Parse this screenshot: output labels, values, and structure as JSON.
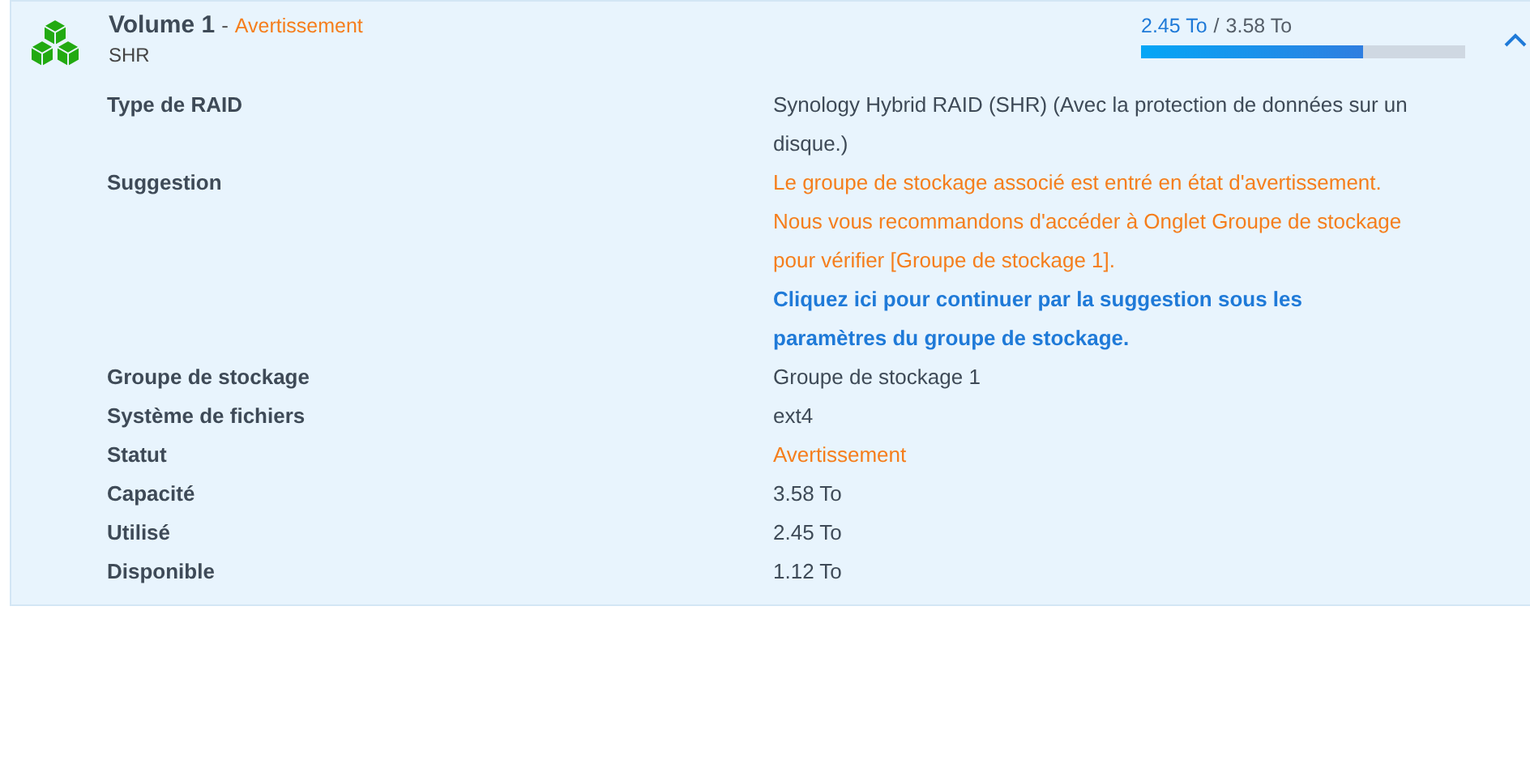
{
  "volume": {
    "name": "Volume 1",
    "separator": "-",
    "status": "Avertissement",
    "type": "SHR",
    "expanded": true,
    "usage": {
      "used": "2.45 To",
      "slash": "/",
      "total": "3.58 To",
      "level": 0.684
    },
    "details": [
      {
        "label": "Type de RAID",
        "kind": "plain",
        "value": "Synology Hybrid RAID (SHR) (Avec la protection de données sur un disque.)"
      },
      {
        "label": "Suggestion",
        "kind": "suggestion",
        "value": "Le groupe de stockage associé est entré en état d'avertissement. Nous vous recommandons d'accéder à Onglet Groupe de stockage pour vérifier [Groupe de stockage 1].",
        "link": "Cliquez ici pour continuer par la suggestion sous les paramètres du groupe de stockage."
      },
      {
        "label": "Groupe de stockage",
        "kind": "plain",
        "value": "Groupe de stockage 1"
      },
      {
        "label": "Système de fichiers",
        "kind": "plain",
        "value": "ext4"
      },
      {
        "label": "Statut",
        "kind": "warning",
        "value": "Avertissement"
      },
      {
        "label": "Capacité",
        "kind": "plain",
        "value": "3.58 To"
      },
      {
        "label": "Utilisé",
        "kind": "plain",
        "value": "2.45 To"
      },
      {
        "label": "Disponible",
        "kind": "plain",
        "value": "1.12 To"
      }
    ]
  }
}
